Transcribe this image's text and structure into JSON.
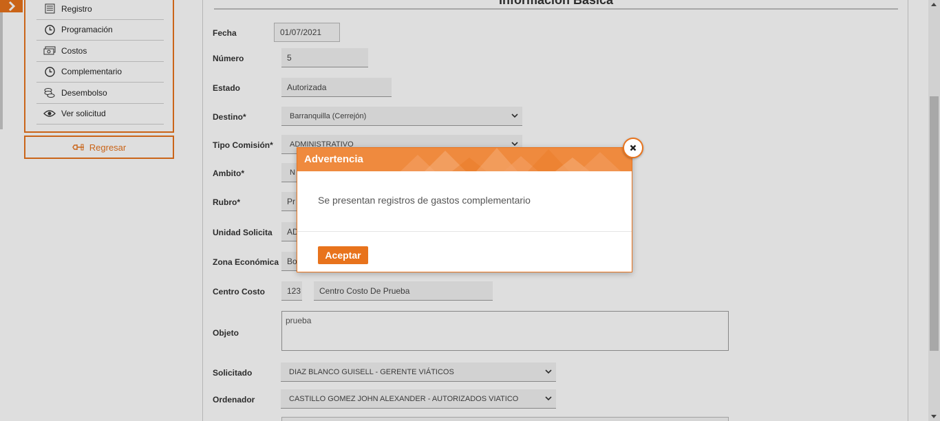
{
  "sidebar": {
    "toggle_icon": "chevron-right-icon",
    "items": [
      {
        "label": "Registro",
        "icon": "list-icon"
      },
      {
        "label": "Programación",
        "icon": "clock-icon"
      },
      {
        "label": "Costos",
        "icon": "money-icon"
      },
      {
        "label": "Complementario",
        "icon": "clock-icon"
      },
      {
        "label": "Desembolso",
        "icon": "coins-icon"
      },
      {
        "label": "Ver solicitud",
        "icon": "eye-icon"
      }
    ],
    "back_label": "Regresar"
  },
  "form": {
    "title": "Información Básica",
    "fecha_label": "Fecha",
    "fecha_value": "01/07/2021",
    "numero_label": "Número",
    "numero_value": "5",
    "estado_label": "Estado",
    "estado_value": "Autorizada",
    "destino_label": "Destino*",
    "destino_value": "Barranquilla (Cerrejón)",
    "tipo_label": "Tipo Comisión*",
    "tipo_value": "ADMINISTRATIVO",
    "ambito_label": "Ambito*",
    "ambito_value": "N",
    "rubro_label": "Rubro*",
    "rubro_value": "Pr",
    "unidad_label": "Unidad Solicita",
    "unidad_value": "AD",
    "zona_label": "Zona Económica",
    "zona_value": "Bo",
    "centro_label": "Centro Costo",
    "centro_code": "123",
    "centro_value": "Centro Costo De Prueba",
    "objeto_label": "Objeto",
    "objeto_value": "prueba",
    "solicitado_label": "Solicitado",
    "solicitado_value": "DIAZ BLANCO GUISELL - GERENTE VIÁTICOS",
    "ordenador_label": "Ordenador",
    "ordenador_value": "CASTILLO GOMEZ JOHN ALEXANDER - AUTORIZADOS VIATICO"
  },
  "dialog": {
    "title": "Advertencia",
    "message": "Se presentan registros de gastos complementario",
    "accept_label": "Aceptar",
    "close_icon": "close-icon"
  },
  "colors": {
    "accent": "#e8731c",
    "header": "#ef8a3e"
  }
}
